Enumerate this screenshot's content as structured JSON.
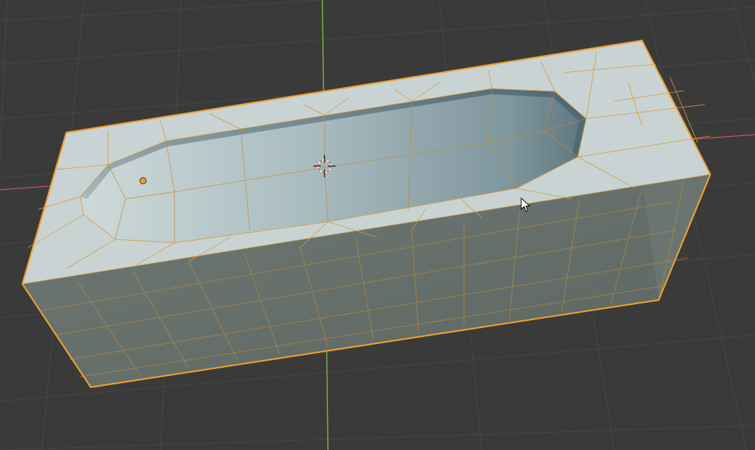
{
  "viewport": {
    "background_color": "#3a3a3a",
    "grid_color": "#4a4a4a",
    "x_axis_color": "#cc4d6e",
    "y_axis_color": "#7fb33a",
    "grid_visible": true
  },
  "mesh_object": {
    "shape": "box-with-pocket",
    "selected": true,
    "selection_outline_color": "#f0a030",
    "wire_color": "#d89a3a",
    "top_face_color": "#c8d2d2",
    "front_face_color": "#66706c",
    "side_face_color": "#6f7a77",
    "pocket_color": "#9fb2b6"
  },
  "origin_point": {
    "icon": "origin-dot-icon",
    "color": "#f09a30"
  },
  "cursor_3d": {
    "icon": "3d-cursor-icon"
  },
  "mouse_pointer": {
    "icon": "mouse-pointer-icon"
  }
}
